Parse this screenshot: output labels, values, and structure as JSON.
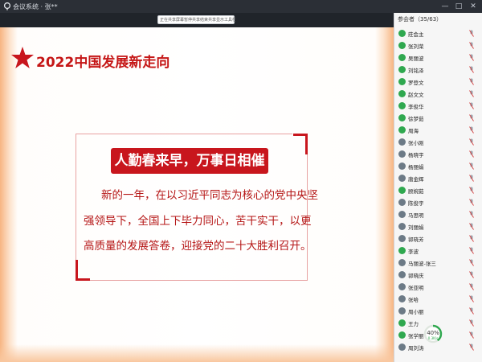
{
  "window": {
    "title": "会议系统 · 张**",
    "minimize_glyph": "—",
    "maximize_glyph": "□",
    "close_glyph": "✕"
  },
  "share_toolbar": {
    "items": [
      "正在共享屏幕",
      "暂停共享",
      "结束共享",
      "显示工具栏"
    ]
  },
  "slide": {
    "title": "2022中国发展新走向",
    "headline": "人勤春来早，万事日相催",
    "body_lines": [
      "新的一年，在以习近平同志为核心的党中央坚",
      "强领导下，全国上下毕力同心，苦干实干，以更",
      "高质量的发展答卷，迎接党的二十大胜利召开。"
    ],
    "accent_color": "#c8161d"
  },
  "panel": {
    "header": "参会者（35/63）",
    "members": [
      {
        "name": "莊会主",
        "avatar": "green"
      },
      {
        "name": "张刘荣",
        "avatar": "green"
      },
      {
        "name": "吴丽波",
        "avatar": "green"
      },
      {
        "name": "刘铭泽",
        "avatar": "green"
      },
      {
        "name": "罗登文",
        "avatar": "green"
      },
      {
        "name": "赵文文",
        "avatar": "green"
      },
      {
        "name": "李俊华",
        "avatar": "green"
      },
      {
        "name": "徐梦茹",
        "avatar": "green"
      },
      {
        "name": "周海",
        "avatar": "green"
      },
      {
        "name": "张小刚",
        "avatar": "photo"
      },
      {
        "name": "杨晓宇",
        "avatar": "photo"
      },
      {
        "name": "杨丽娟",
        "avatar": "photo"
      },
      {
        "name": "唐金辉",
        "avatar": "photo"
      },
      {
        "name": "顾婉茹",
        "avatar": "green"
      },
      {
        "name": "陈俊宇",
        "avatar": "photo"
      },
      {
        "name": "马思明",
        "avatar": "photo"
      },
      {
        "name": "刘丽娟",
        "avatar": "photo"
      },
      {
        "name": "郭晓芳",
        "avatar": "photo"
      },
      {
        "name": "李波",
        "avatar": "green"
      },
      {
        "name": "马丽波-张三",
        "avatar": "photo"
      },
      {
        "name": "郭晓庆",
        "avatar": "photo"
      },
      {
        "name": "张亚明",
        "avatar": "photo"
      },
      {
        "name": "张哈",
        "avatar": "photo"
      },
      {
        "name": "周小丽",
        "avatar": "photo"
      },
      {
        "name": "王力",
        "avatar": "green"
      },
      {
        "name": "张学丽",
        "avatar": "green"
      },
      {
        "name": "周刘涛",
        "avatar": "photo"
      }
    ]
  },
  "network_meter": {
    "value_pct": 40,
    "label": "40%",
    "sub": "0.3K/s"
  }
}
